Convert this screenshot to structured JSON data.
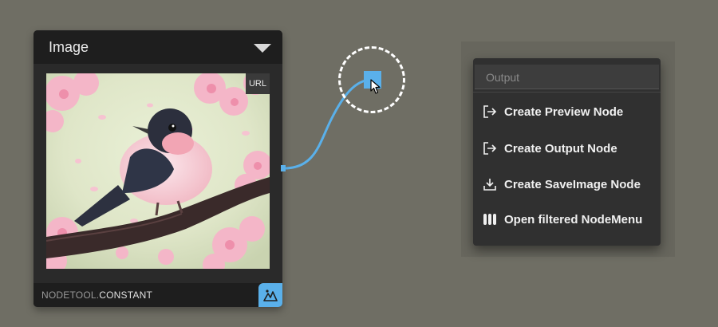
{
  "node": {
    "title": "Image",
    "url_badge": "URL",
    "footer_namespace": "NODETOOL.",
    "footer_name": "CONSTANT"
  },
  "context_menu": {
    "search_placeholder": "Output",
    "items": [
      {
        "label": "Create Preview Node",
        "icon": "arrow-out-icon"
      },
      {
        "label": "Create Output Node",
        "icon": "arrow-out-icon"
      },
      {
        "label": "Create SaveImage Node",
        "icon": "download-icon"
      },
      {
        "label": "Open filtered NodeMenu",
        "icon": "columns-icon"
      }
    ]
  },
  "colors": {
    "canvas": "#6f6e64",
    "accent": "#5ab0ea",
    "node_bg": "#2a2a2a",
    "menu_bg": "#303030"
  }
}
